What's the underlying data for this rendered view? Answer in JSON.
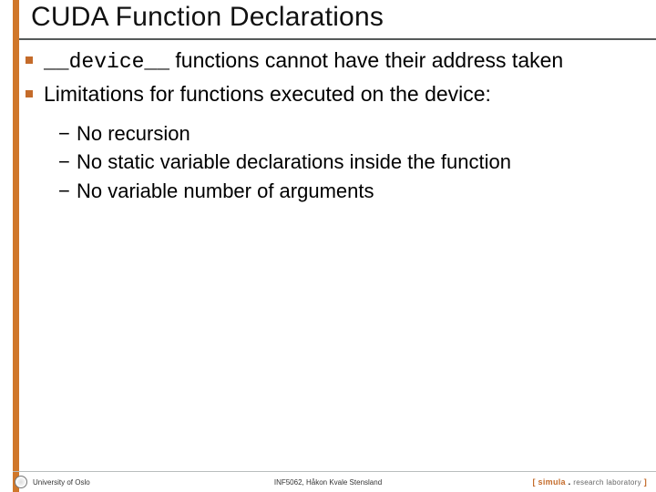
{
  "title": "CUDA Function Declarations",
  "bullets": [
    {
      "code": "__device__",
      "rest": " functions cannot have their address taken"
    },
    {
      "text": "Limitations for functions executed on the device:"
    }
  ],
  "subbullets": [
    "No recursion",
    "No static variable declarations inside the function",
    "No variable number of arguments"
  ],
  "footer": {
    "left": "University of Oslo",
    "center": "INF5062, Håkon Kvale Stensland",
    "right": {
      "open": "[ ",
      "brand": "simula",
      "sep": " . ",
      "rest": "research laboratory",
      "close": " ]"
    }
  }
}
